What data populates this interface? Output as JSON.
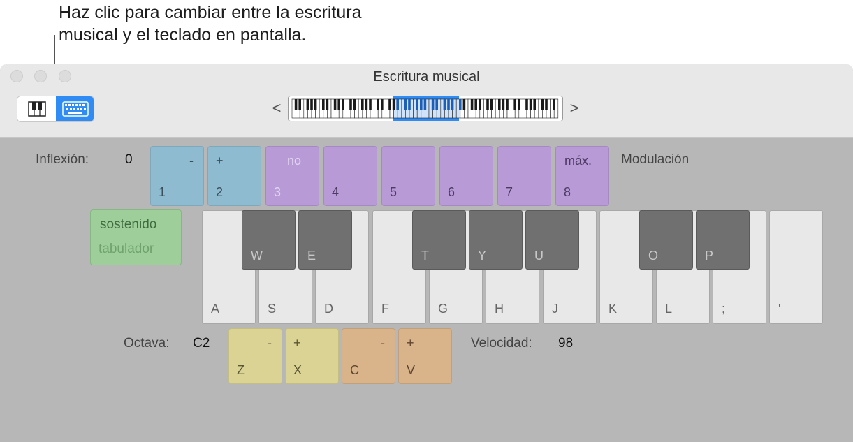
{
  "callout": {
    "line1": "Haz clic para cambiar entre la escritura",
    "line2": "musical y el teclado en pantalla."
  },
  "window": {
    "title": "Escritura musical"
  },
  "mode_switch": {
    "left_icon": "piano-icon",
    "right_icon": "keyboard-icon",
    "selected": "keyboard",
    "accent": "#2f8cf4"
  },
  "range": {
    "prev": "<",
    "next": ">"
  },
  "pitch": {
    "label": "Inflexión:",
    "value": "0"
  },
  "modulation": {
    "label": "Modulación"
  },
  "pads": [
    {
      "top": "-",
      "bottom": "1",
      "color": "blue"
    },
    {
      "top": "+",
      "bottom": "2",
      "color": "blue"
    },
    {
      "top": "no",
      "bottom": "3",
      "color": "purple"
    },
    {
      "top": "",
      "bottom": "4",
      "color": "purple"
    },
    {
      "top": "",
      "bottom": "5",
      "color": "purple"
    },
    {
      "top": "",
      "bottom": "6",
      "color": "purple"
    },
    {
      "top": "",
      "bottom": "7",
      "color": "purple"
    },
    {
      "top": "máx.",
      "bottom": "8",
      "color": "purple"
    }
  ],
  "sustain": {
    "label": "sostenido",
    "key": "tabulador"
  },
  "white_keys": [
    "A",
    "S",
    "D",
    "F",
    "G",
    "H",
    "J",
    "K",
    "L",
    ";",
    "'"
  ],
  "black_keys": [
    "W",
    "E",
    "T",
    "Y",
    "U",
    "O",
    "P"
  ],
  "octave": {
    "label": "Octava:",
    "value": "C2"
  },
  "octave_pads": [
    {
      "top": "-",
      "bottom": "Z"
    },
    {
      "top": "+",
      "bottom": "X"
    }
  ],
  "velocity_pads": [
    {
      "top": "-",
      "bottom": "C"
    },
    {
      "top": "+",
      "bottom": "V"
    }
  ],
  "velocity": {
    "label": "Velocidad:",
    "value": "98"
  }
}
